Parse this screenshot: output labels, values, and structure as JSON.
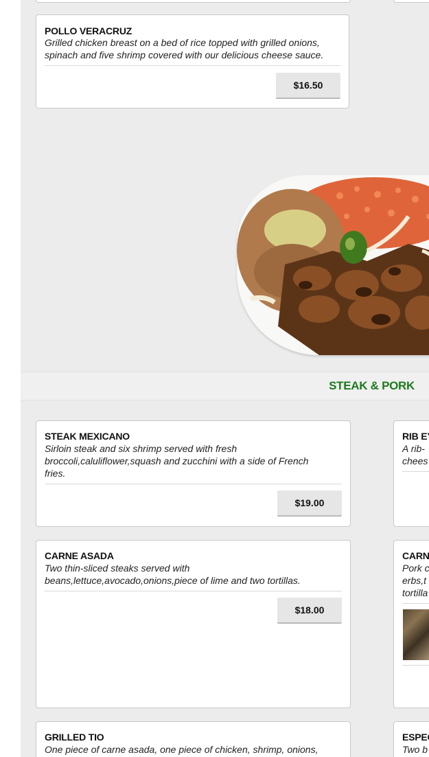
{
  "colors": {
    "section_title": "#1e7a1e",
    "page_bg": "#ececec",
    "card_bg": "#ffffff",
    "price_button_bg": "#e6e6e6"
  },
  "menu_top": {
    "items": [
      {
        "title": "POLLO VERACRUZ",
        "description": "Grilled chicken breast on a bed of rice topped with grilled onions, spinach and five shrimp covered with our delicious cheese sauce.",
        "price": "$16.50"
      }
    ]
  },
  "food_image": {
    "icon": "plate-of-carne-asada-image"
  },
  "section": {
    "title": "STEAK & PORK"
  },
  "menu_section": {
    "left_items": [
      {
        "title": "STEAK MEXICANO",
        "description": "Sirloin steak and six shrimp served with fresh broccoli,caluliflower,squash and zucchini with a side of French fries.",
        "price": "$19.00"
      },
      {
        "title": "CARNE ASADA",
        "description": "Two thin-sliced steaks served with beans,lettuce,avocado,onions,piece of lime and two tortillas.",
        "price": "$18.00"
      },
      {
        "title": "GRILLED TIO",
        "description": "One piece of carne asada, one piece of chicken, shrimp, onions,"
      }
    ],
    "right_items": [
      {
        "title": "RIB EY",
        "description": "A rib-",
        "description_line2": "chees"
      },
      {
        "title": "CARN",
        "description": "Pork c",
        "description_line2": "erbs,t",
        "description_line3": "tortilla"
      },
      {
        "title": "ESPEC",
        "description": "Two b"
      }
    ]
  }
}
